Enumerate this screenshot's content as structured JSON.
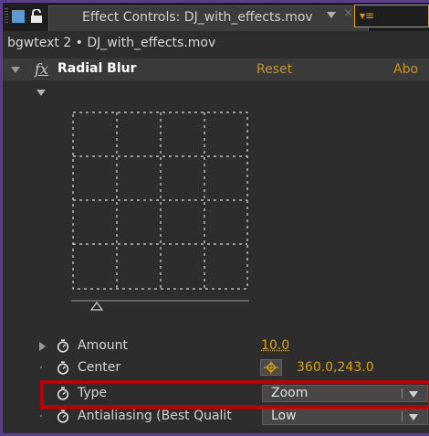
{
  "panel": {
    "tab_title": "Effect Controls: DJ_with_effects.mov",
    "close_glyph": "×",
    "menu_glyph": "▾≡",
    "subtitle": "bgwtext 2 • DJ_with_effects.mov"
  },
  "effect": {
    "fx_label": "fx",
    "name": "Radial Blur",
    "reset_label": "Reset",
    "about_label": "Abo"
  },
  "params": {
    "amount": {
      "label": "Amount",
      "value": "10.0"
    },
    "center": {
      "label": "Center",
      "value": "360.0,243.0"
    },
    "type": {
      "label": "Type",
      "selected": "Zoom",
      "options": [
        "Zoom"
      ]
    },
    "antialiasing": {
      "label": "Antialiasing (Best Qualit",
      "selected": "Low"
    }
  },
  "colors": {
    "accent_orange": "#e0a000",
    "highlight_red": "#c00000",
    "panel_border": "#5a3f86",
    "icon_blue": "#5b9bd5"
  },
  "icons": [
    "grip-icon",
    "panel-square-icon",
    "lock-icon",
    "chevron-down-icon",
    "close-icon",
    "panel-menu-icon",
    "fx-icon",
    "stopwatch-icon",
    "crosshair-icon"
  ]
}
